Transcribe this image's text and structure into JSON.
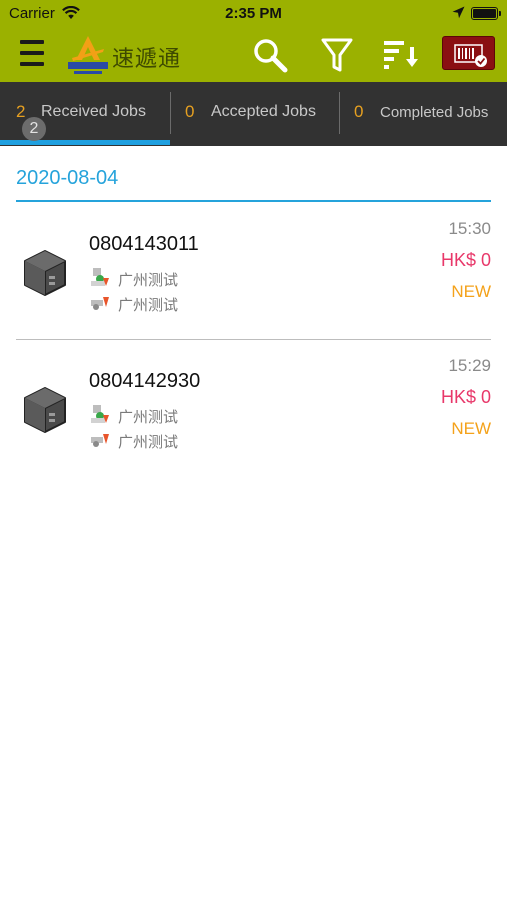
{
  "status_bar": {
    "carrier": "Carrier",
    "time": "2:35 PM",
    "icons": [
      "wifi-icon",
      "location-arrow-icon",
      "battery-icon"
    ]
  },
  "nav_bar": {
    "app_name": "速遞通",
    "logo_icon": "autotoll-logo",
    "actions": [
      "menu-icon",
      "search-icon",
      "filter-icon",
      "sort-icon",
      "barcode-scan-icon"
    ],
    "colors": {
      "bar": "#9bb100",
      "scan_button": "#8a0f12"
    }
  },
  "tabs": [
    {
      "count": "2",
      "label": "Received Jobs",
      "selected": true
    },
    {
      "count": "0",
      "label": "Accepted Jobs",
      "selected": false
    },
    {
      "count": "0",
      "label": "Completed Jobs",
      "selected": false
    }
  ],
  "badge": "2",
  "date_header": "2020-08-04",
  "jobs": [
    {
      "id": "0804143011",
      "pickup": "广州测试",
      "dropoff": "广州测试",
      "time": "15:30",
      "price": "HK$ 0",
      "status": "NEW"
    },
    {
      "id": "0804142930",
      "pickup": "广州测试",
      "dropoff": "广州测试",
      "time": "15:29",
      "price": "HK$ 0",
      "status": "NEW"
    }
  ],
  "colors": {
    "accent": "#25a3db",
    "count": "#e6a021",
    "price": "#e8386a",
    "status_new": "#f4a21b",
    "tab_bar": "#323232"
  }
}
